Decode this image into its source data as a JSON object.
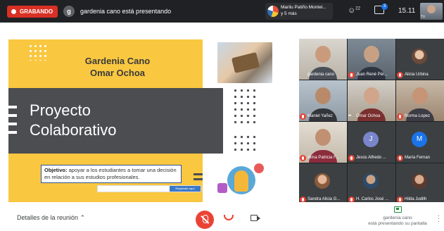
{
  "topbar": {
    "recording_label": "GRABANDO",
    "presenter_initial": "g",
    "presenter_text": "gardenia cano está presentando",
    "speaker_line1": "Marilu Patiño Montel...",
    "speaker_line2": "y 5 más",
    "people_count": "22",
    "chat_badge": "3",
    "clock": "15.11",
    "self_label": "Tú"
  },
  "slide": {
    "authors_line1": "Gardenia Cano",
    "authors_line2": "Omar Ochoa",
    "title_line1": "Proyecto",
    "title_line2": "Colaborativo",
    "objective_label": "Objetivo:",
    "objective_text": " apoyar a los estudiantes a tomar una decisión en relación a sus estudios profesionales.",
    "search_button": "Registrate aquí"
  },
  "participants": [
    {
      "name": "gardenia cano",
      "muted": false
    },
    {
      "name": "Juan René Pér...",
      "muted": true
    },
    {
      "name": "Alicia Urbina",
      "muted": true
    },
    {
      "name": "Maniel Yañez",
      "muted": true
    },
    {
      "name": "Omar Ochoa",
      "muted": false
    },
    {
      "name": "Norma Lopez",
      "muted": true
    },
    {
      "name": "Alma Patricia F...",
      "muted": true
    },
    {
      "name": "Jesús Alfredo ...",
      "muted": true,
      "initial": "J"
    },
    {
      "name": "María Fernan",
      "muted": true,
      "initial": "M"
    },
    {
      "name": "Sandra Alicia G...",
      "muted": true
    },
    {
      "name": "H. Carlos José ...",
      "muted": true
    },
    {
      "name": "Hilda Judith",
      "muted": true
    }
  ],
  "bottombar": {
    "details_label": "Detalles de la reunión",
    "present_line1": "gardenia cano",
    "present_line2": "está presentando su pantalla"
  },
  "colors": {
    "accent_yellow": "#f9c740",
    "slide_gray": "#4b4d50",
    "record_red": "#d93025",
    "mute_red": "#ea4335"
  }
}
